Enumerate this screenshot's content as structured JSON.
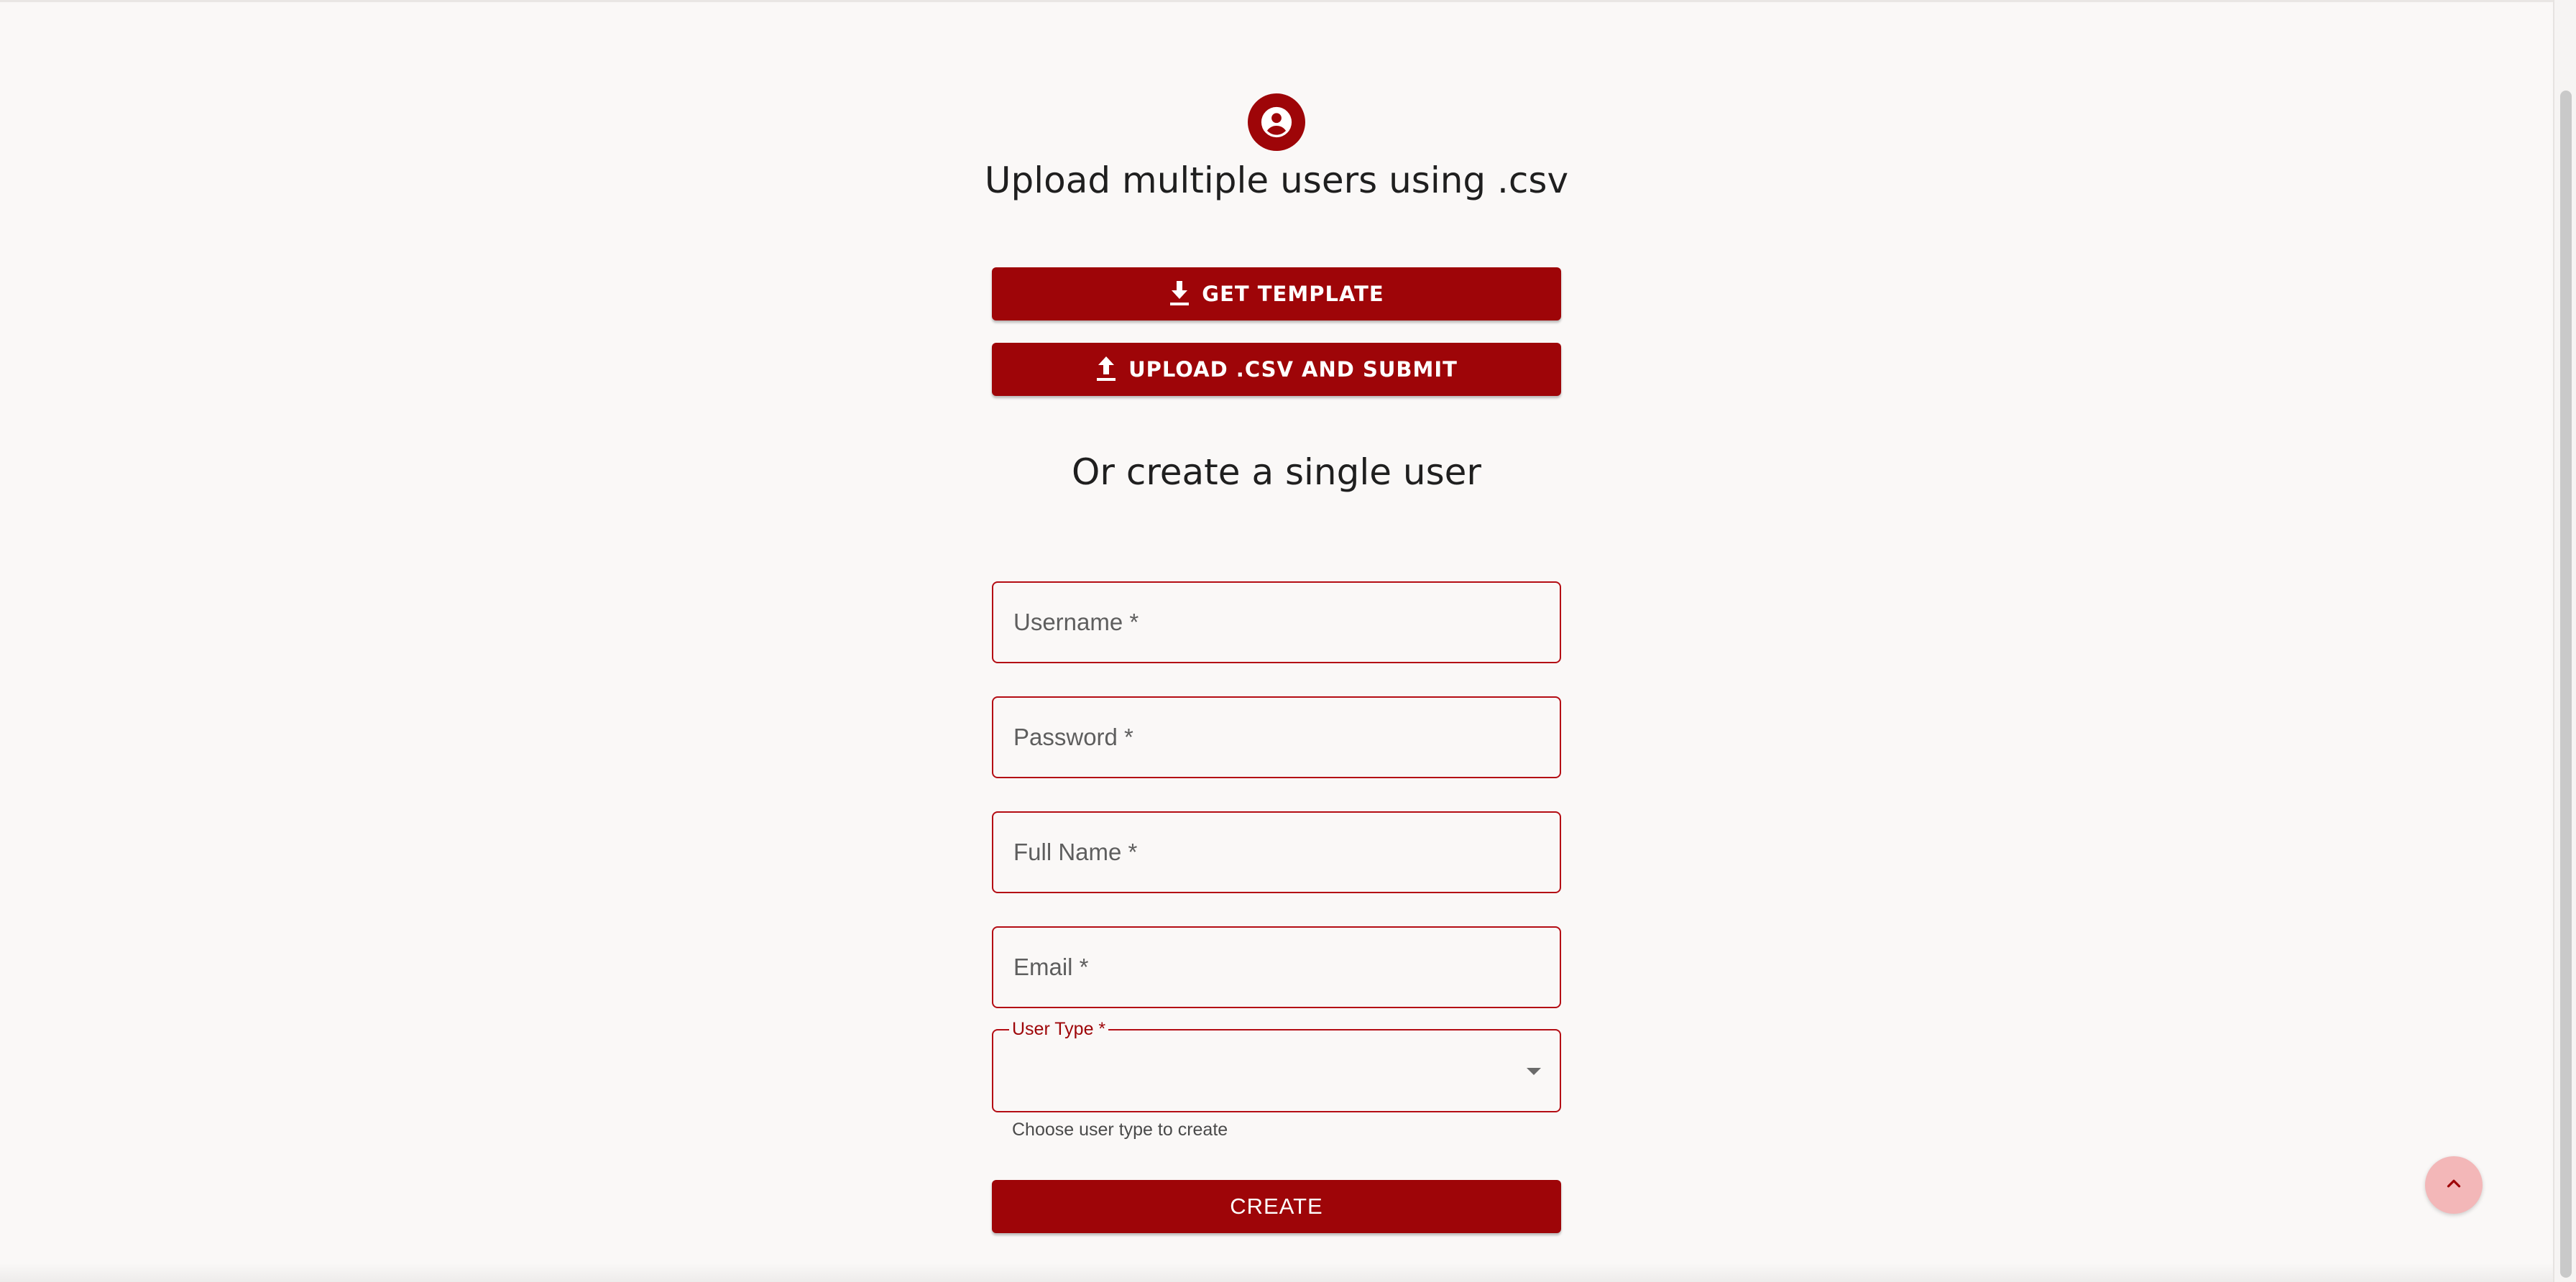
{
  "header": {
    "title": "Upload multiple users using .csv",
    "icon": "account-circle-icon"
  },
  "bulk_actions": {
    "get_template_label": "GET TEMPLATE",
    "upload_label": "UPLOAD .CSV AND SUBMIT"
  },
  "single_user": {
    "title": "Or create a single user",
    "fields": {
      "username": {
        "label": "Username *",
        "value": ""
      },
      "password": {
        "label": "Password *",
        "value": ""
      },
      "full_name": {
        "label": "Full Name *",
        "value": ""
      },
      "email": {
        "label": "Email *",
        "value": ""
      }
    },
    "user_type": {
      "label": "User Type *",
      "value": "",
      "helper_text": "Choose user type to create"
    },
    "create_label": "CREATE"
  },
  "colors": {
    "brand": "#9e0508",
    "border": "#b40d14",
    "background": "#faf8f7",
    "scroll_top_button": "#f3b7b8"
  }
}
